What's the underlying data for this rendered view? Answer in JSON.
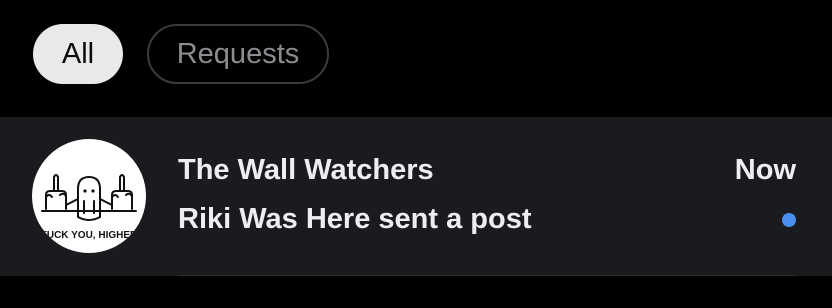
{
  "tabs": {
    "all_label": "All",
    "requests_label": "Requests"
  },
  "conversation": {
    "title": "The Wall Watchers",
    "preview": "Riki Was Here sent a post",
    "time": "Now",
    "unread": true,
    "avatar_text": "FUCK YOU, HIGHER"
  },
  "colors": {
    "background": "#000000",
    "row_background": "#1a1b1e",
    "unread_dot": "#4a8ff0",
    "active_tab": "#e9e9ea"
  }
}
